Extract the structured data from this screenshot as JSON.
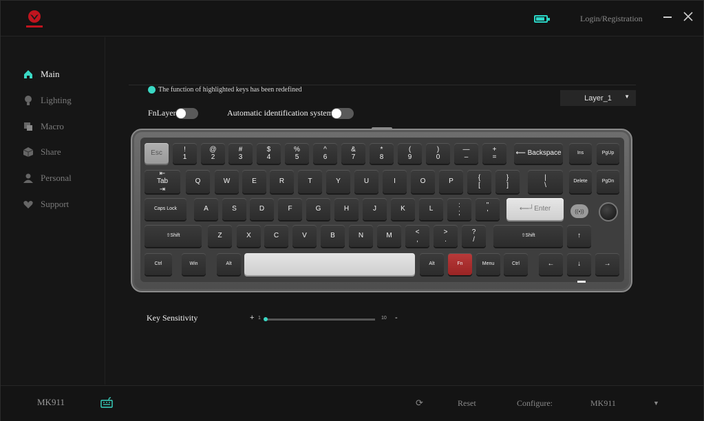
{
  "header": {
    "login_label": "Login/Registration",
    "battery_level": 0.85,
    "accent_color": "#3ad8c4",
    "brand_color": "#c0141e"
  },
  "sidebar": {
    "items": [
      {
        "label": "Main",
        "icon": "home-icon",
        "active": true
      },
      {
        "label": "Lighting",
        "icon": "bulb-icon",
        "active": false
      },
      {
        "label": "Macro",
        "icon": "macro-icon",
        "active": false
      },
      {
        "label": "Share",
        "icon": "cube-icon",
        "active": false
      },
      {
        "label": "Personal",
        "icon": "user-icon",
        "active": false
      },
      {
        "label": "Support",
        "icon": "heart-icon",
        "active": false
      }
    ]
  },
  "main": {
    "notice": "The function of highlighted keys has been redefined",
    "layer_select": "Layer_1",
    "fnlayer_label": "FnLayer",
    "fnlayer_on": false,
    "auto_id_label": "Automatic identification system",
    "auto_id_on": false,
    "sensitivity": {
      "label": "Key Sensitivity",
      "plus": "+",
      "minus": "-",
      "min": "1",
      "max": "10",
      "value": 1
    }
  },
  "keyboard": {
    "rows": [
      [
        [
          "Esc"
        ],
        [
          "!",
          "1"
        ],
        [
          "@",
          "2"
        ],
        [
          "#",
          "3"
        ],
        [
          "$",
          "4"
        ],
        [
          "%",
          "5"
        ],
        [
          "^",
          "6"
        ],
        [
          "&",
          "7"
        ],
        [
          "*",
          "8"
        ],
        [
          "(",
          "9"
        ],
        [
          ")",
          "0"
        ],
        [
          "—",
          "–"
        ],
        [
          "+",
          "="
        ],
        [
          "⟵ Backspace"
        ],
        [
          "Ins"
        ],
        [
          "PgUp"
        ]
      ],
      [
        [
          "⇤",
          "Tab",
          "⇥"
        ],
        [
          "Q"
        ],
        [
          "W"
        ],
        [
          "E"
        ],
        [
          "R"
        ],
        [
          "T"
        ],
        [
          "Y"
        ],
        [
          "U"
        ],
        [
          "I"
        ],
        [
          "O"
        ],
        [
          "P"
        ],
        [
          "{",
          "["
        ],
        [
          "}",
          "]"
        ],
        [
          "|",
          "\\"
        ],
        [
          "Delete"
        ],
        [
          "PgDn"
        ]
      ],
      [
        [
          "Caps Lock"
        ],
        [
          "A"
        ],
        [
          "S"
        ],
        [
          "D"
        ],
        [
          "F"
        ],
        [
          "G"
        ],
        [
          "H"
        ],
        [
          "J"
        ],
        [
          "K"
        ],
        [
          "L"
        ],
        [
          ":",
          ";"
        ],
        [
          "\"",
          "'"
        ],
        [
          "⟵┘Enter"
        ]
      ],
      [
        [
          "⇧Shift"
        ],
        [
          "Z"
        ],
        [
          "X"
        ],
        [
          "C"
        ],
        [
          "V"
        ],
        [
          "B"
        ],
        [
          "N"
        ],
        [
          "M"
        ],
        [
          "<",
          ","
        ],
        [
          ">",
          "."
        ],
        [
          "?",
          "/"
        ],
        [
          "⇧Shift"
        ],
        [
          "↑"
        ]
      ],
      [
        [
          "Ctrl"
        ],
        [
          "Win"
        ],
        [
          "Alt"
        ],
        [
          ""
        ],
        [
          "Alt"
        ],
        [
          "Fn"
        ],
        [
          "Menu"
        ],
        [
          "Ctrl"
        ],
        [
          "←"
        ],
        [
          "↓"
        ],
        [
          "→"
        ]
      ]
    ],
    "led_label": "((•))"
  },
  "footer": {
    "model": "MK911",
    "reset_label": "Reset",
    "configure_label": "Configure:",
    "configure_value": "MK911"
  }
}
